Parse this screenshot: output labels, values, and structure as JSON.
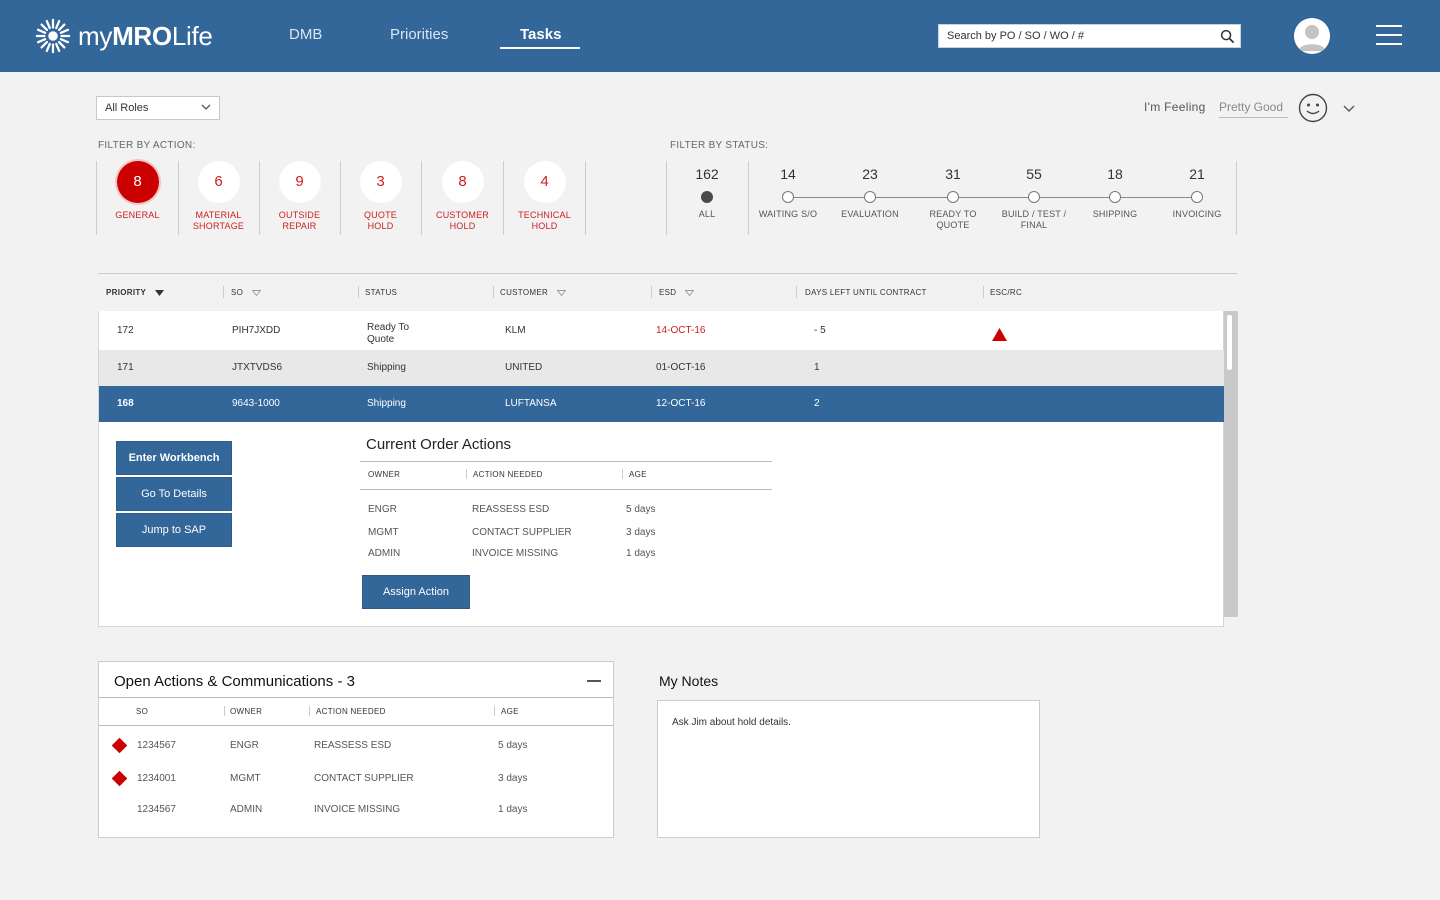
{
  "header": {
    "logo_prefix": "my",
    "logo_bold": "MRO",
    "logo_suffix": "Life",
    "nav": [
      "DMB",
      "Priorities",
      "Tasks"
    ],
    "active_nav": "Tasks",
    "search_placeholder": "Search by PO / SO / WO / #"
  },
  "role_select": {
    "value": "All Roles"
  },
  "feeling": {
    "label": "I'm Feeling",
    "value": "Pretty Good"
  },
  "filter_action": {
    "label": "FILTER BY ACTION:",
    "items": [
      {
        "count": "8",
        "label_1": "GENERAL",
        "label_2": "",
        "selected": true
      },
      {
        "count": "6",
        "label_1": "MATERIAL",
        "label_2": "SHORTAGE"
      },
      {
        "count": "9",
        "label_1": "OUTSIDE",
        "label_2": "REPAIR"
      },
      {
        "count": "3",
        "label_1": "QUOTE",
        "label_2": "HOLD"
      },
      {
        "count": "8",
        "label_1": "CUSTOMER",
        "label_2": "HOLD"
      },
      {
        "count": "4",
        "label_1": "TECHNICAL",
        "label_2": "HOLD"
      }
    ]
  },
  "filter_status": {
    "label": "FILTER BY STATUS:",
    "items": [
      {
        "count": "162",
        "label_1": "ALL",
        "label_2": "",
        "selected": true
      },
      {
        "count": "14",
        "label_1": "WAITING S/O",
        "label_2": ""
      },
      {
        "count": "23",
        "label_1": "EVALUATION",
        "label_2": ""
      },
      {
        "count": "31",
        "label_1": "READY TO",
        "label_2": "QUOTE"
      },
      {
        "count": "55",
        "label_1": "BUILD / TEST /",
        "label_2": "FINAL"
      },
      {
        "count": "18",
        "label_1": "SHIPPING",
        "label_2": ""
      },
      {
        "count": "21",
        "label_1": "INVOICING",
        "label_2": ""
      }
    ]
  },
  "table": {
    "columns": [
      "PRIORITY",
      "SO",
      "STATUS",
      "CUSTOMER",
      "ESD",
      "DAYS LEFT UNTIL CONTRACT",
      "ESC/RC"
    ],
    "rows": [
      {
        "priority": "172",
        "so": "PIH7JXDD",
        "status_1": "Ready To",
        "status_2": "Quote",
        "customer": "KLM",
        "esd": "14-OCT-16",
        "days": "- 5"
      },
      {
        "priority": "171",
        "so": "JTXTVDS6",
        "status": "Shipping",
        "customer": "UNITED",
        "esd": "01-OCT-16",
        "days": "1"
      },
      {
        "priority": "168",
        "so": "9643-1000",
        "status": "Shipping",
        "customer": "LUFTANSA",
        "esd": "12-OCT-16",
        "days": "2"
      }
    ]
  },
  "detail": {
    "buttons": [
      "Enter Workbench",
      "Go To Details",
      "Jump to SAP"
    ],
    "title": "Current Order Actions",
    "columns": [
      "OWNER",
      "ACTION NEEDED",
      "AGE"
    ],
    "rows": [
      {
        "owner": "ENGR",
        "action": "REASSESS ESD",
        "age": "5 days"
      },
      {
        "owner": "MGMT",
        "action": "CONTACT SUPPLIER",
        "age": "3 days"
      },
      {
        "owner": "ADMIN",
        "action": "INVOICE MISSING",
        "age": "1 days"
      }
    ],
    "assign_button": "Assign Action"
  },
  "open_actions": {
    "title": "Open Actions & Communications - 3",
    "columns": [
      "SO",
      "OWNER",
      "ACTION NEEDED",
      "AGE"
    ],
    "rows": [
      {
        "so": "1234567",
        "owner": "ENGR",
        "action": "REASSESS ESD",
        "age": "5 days"
      },
      {
        "so": "1234001",
        "owner": "MGMT",
        "action": "CONTACT SUPPLIER",
        "age": "3 days"
      },
      {
        "so": "1234567",
        "owner": "ADMIN",
        "action": "INVOICE MISSING",
        "age": "1 days"
      }
    ]
  },
  "notes": {
    "title": "My Notes",
    "text": "Ask Jim about hold details."
  },
  "colors": {
    "brand": "#336699",
    "alert": "#cc0000",
    "background": "#f2f2f2"
  }
}
